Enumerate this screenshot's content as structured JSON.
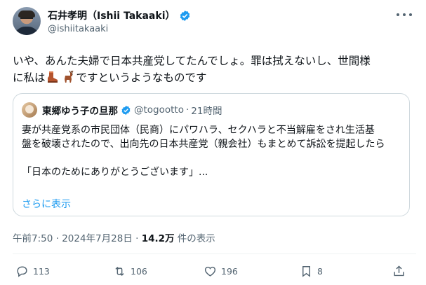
{
  "author": {
    "display_name": "石井孝明（Ishii Takaaki）",
    "handle": "@ishiitakaaki"
  },
  "tweet": {
    "text_line1": "いや、あんた夫婦で日本共産党してたんでしょ。罪は拭えないし、世間様",
    "text_line2_before": "に私は",
    "text_line2_after": "ですというようなものです",
    "emojis": [
      "boot-emoji",
      "deer-emoji"
    ]
  },
  "quote": {
    "name": "東郷ゆう子の旦那",
    "handle": "@togootto",
    "separator": "·",
    "time": "21時間",
    "body": "妻が共産党系の市民団体（民商）にパワハラ、セクハラと不当解雇をされ生活基\n盤を破壊されたので、出向先の日本共産党（親会社）もまとめて訴訟を提起したら\n\n「日本のためにありがとうございます」...",
    "show_more": "さらに表示"
  },
  "meta": {
    "time": "午前7:50 · 2024年7月28日 · ",
    "views_count": "14.2万",
    "views_label": " 件の表示"
  },
  "actions": {
    "replies": "113",
    "retweets": "106",
    "likes": "196",
    "bookmarks": "8"
  },
  "colors": {
    "verified": "#1d9bf0",
    "link": "#1d9bf0",
    "secondary_text": "#536471"
  }
}
